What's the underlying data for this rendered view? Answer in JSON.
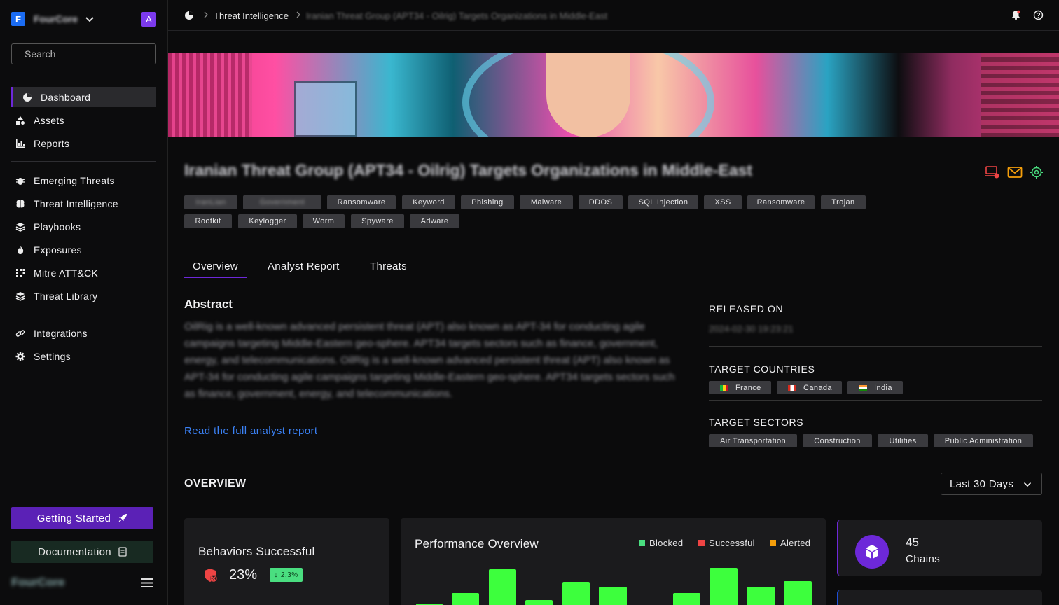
{
  "sidebar": {
    "org_initial": "F",
    "org_name": "FourCore",
    "avatar_initial": "A",
    "search_placeholder": "Search",
    "items": [
      {
        "label": "Dashboard",
        "icon": "pie-chart-icon",
        "active": true
      },
      {
        "label": "Assets",
        "icon": "shapes-icon"
      },
      {
        "label": "Reports",
        "icon": "bar-chart-icon"
      },
      {
        "label": "Emerging Threats",
        "icon": "bug-icon"
      },
      {
        "label": "Threat Intelligence",
        "icon": "brain-icon"
      },
      {
        "label": "Playbooks",
        "icon": "layers-icon"
      },
      {
        "label": "Exposures",
        "icon": "flame-icon"
      },
      {
        "label": "Mitre ATT&CK",
        "icon": "grid-dots-icon"
      },
      {
        "label": "Threat Library",
        "icon": "layers-icon"
      },
      {
        "label": "Integrations",
        "icon": "link-icon"
      },
      {
        "label": "Settings",
        "icon": "gear-icon"
      }
    ],
    "getting_started": "Getting Started",
    "documentation": "Documentation",
    "footer_logo": "FourCore"
  },
  "breadcrumb": {
    "section": "Threat Intelligence",
    "current": "Iranian Threat Group (APT34 - Oilrig) Targets Organizations in Middle-East"
  },
  "report": {
    "title": "Iranian Threat Group (APT34 - Oilrig) Targets Organizations in Middle-East",
    "tags_row1": [
      "IranLian",
      "Government",
      "Ransomware",
      "Keyword",
      "Phishing",
      "Malware",
      "DDOS",
      "SQL Injection",
      "XSS",
      "Ransomware",
      "Trojan"
    ],
    "tags_row2": [
      "Rootkit",
      "Keylogger",
      "Worm",
      "Spyware",
      "Adware"
    ],
    "tabs": [
      "Overview",
      "Analyst Report",
      "Threats"
    ],
    "abstract_heading": "Abstract",
    "abstract": "OilRig is a well-known advanced persistent threat (APT) also known as APT-34 for conducting agile campaigns targeting Middle-Eastern geo-sphere. APT34 targets sectors such as finance, government, energy, and telecommunications. OilRig is a well-known advanced persistent threat (APT) also known as APT-34 for conducting agile campaigns targeting Middle-Eastern geo-sphere. APT34 targets sectors such as finance, government, energy, and telecommunications.",
    "read_link": "Read the full analyst report",
    "released_label": "RELEASED ON",
    "released_value": "2024-02-30 19:23:21",
    "countries_label": "TARGET COUNTRIES",
    "countries": [
      "France",
      "Canada",
      "India"
    ],
    "sectors_label": "TARGET SECTORS",
    "sectors": [
      "Air Transportation",
      "Construction",
      "Utilities",
      "Public Administration"
    ]
  },
  "overview": {
    "heading": "OVERVIEW",
    "range": "Last 30 Days",
    "behaviors": {
      "title": "Behaviors Successful",
      "value": "23%",
      "delta": "2.3%"
    },
    "performance": {
      "title": "Performance Overview",
      "legend": [
        {
          "name": "Blocked",
          "color": "#4ade80"
        },
        {
          "name": "Successful",
          "color": "#ef4444"
        },
        {
          "name": "Alerted",
          "color": "#f59e0b"
        }
      ]
    },
    "chains": {
      "value": "45",
      "label": "Chains"
    }
  },
  "colors": {
    "accent": "#6d28d9",
    "bar": "#3dff3d",
    "link": "#3b82f6"
  }
}
